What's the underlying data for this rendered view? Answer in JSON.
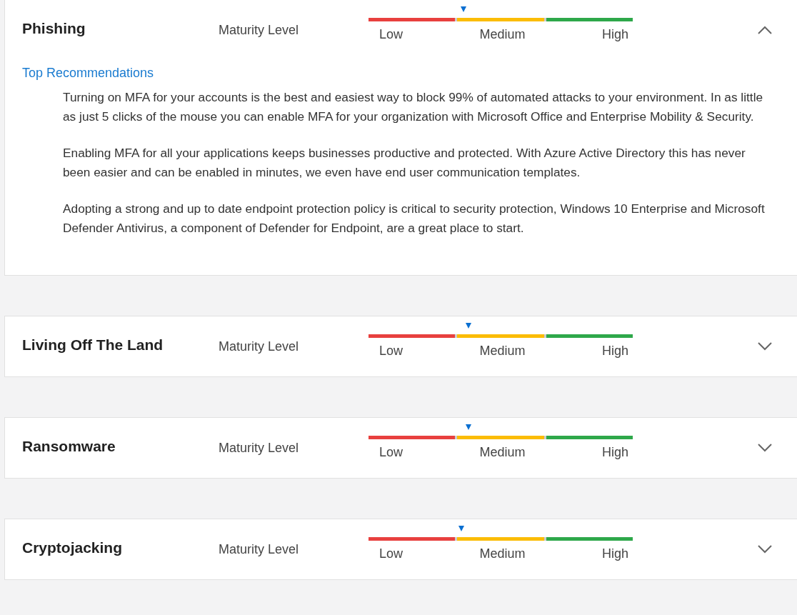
{
  "sections": [
    {
      "title": "Phishing",
      "meter_label": "Maturity Level",
      "level": 0.36,
      "scale": [
        "Low",
        "Medium",
        "High"
      ],
      "expanded": true,
      "recommendations": {
        "heading": "Top Recommendations",
        "paragraphs": [
          "Turning on MFA for your accounts is the best and easiest way to block 99% of automated attacks to your environment. In as little as just 5 clicks of the mouse you can enable MFA for your organization with Microsoft Office and Enterprise Mobility & Security.",
          "Enabling MFA for all your applications keeps businesses productive and protected. With Azure Active Directory this has never been easier and can be enabled in minutes, we even have end user communication templates.",
          "Adopting a strong and up to date endpoint protection policy is critical to security protection, Windows 10 Enterprise and Microsoft Defender Antivirus, a component of Defender for Endpoint, are a great place to start."
        ]
      }
    },
    {
      "title": "Living Off The Land",
      "meter_label": "Maturity Level",
      "level": 0.378,
      "scale": [
        "Low",
        "Medium",
        "High"
      ],
      "expanded": false
    },
    {
      "title": "Ransomware",
      "meter_label": "Maturity Level",
      "level": 0.378,
      "scale": [
        "Low",
        "Medium",
        "High"
      ],
      "expanded": false
    },
    {
      "title": "Cryptojacking",
      "meter_label": "Maturity Level",
      "level": 0.351,
      "scale": [
        "Low",
        "Medium",
        "High"
      ],
      "expanded": false
    }
  ]
}
